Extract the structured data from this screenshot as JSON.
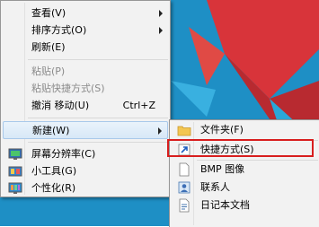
{
  "main_menu": {
    "items": [
      {
        "label": "查看(V)"
      },
      {
        "label": "排序方式(O)"
      },
      {
        "label": "刷新(E)"
      },
      {
        "label": "粘贴(P)"
      },
      {
        "label": "粘贴快捷方式(S)"
      },
      {
        "label": "撤消 移动(U)",
        "shortcut": "Ctrl+Z"
      },
      {
        "label": "新建(W)"
      },
      {
        "label": "屏幕分辨率(C)"
      },
      {
        "label": "小工具(G)"
      },
      {
        "label": "个性化(R)"
      }
    ]
  },
  "new_submenu": {
    "items": [
      {
        "label": "文件夹(F)"
      },
      {
        "label": "快捷方式(S)"
      },
      {
        "label": "BMP 图像"
      },
      {
        "label": "联系人"
      },
      {
        "label": "日记本文档"
      }
    ]
  },
  "colors": {
    "desktop": "#1e8fc5",
    "highlight_border": "#d81e1e"
  }
}
